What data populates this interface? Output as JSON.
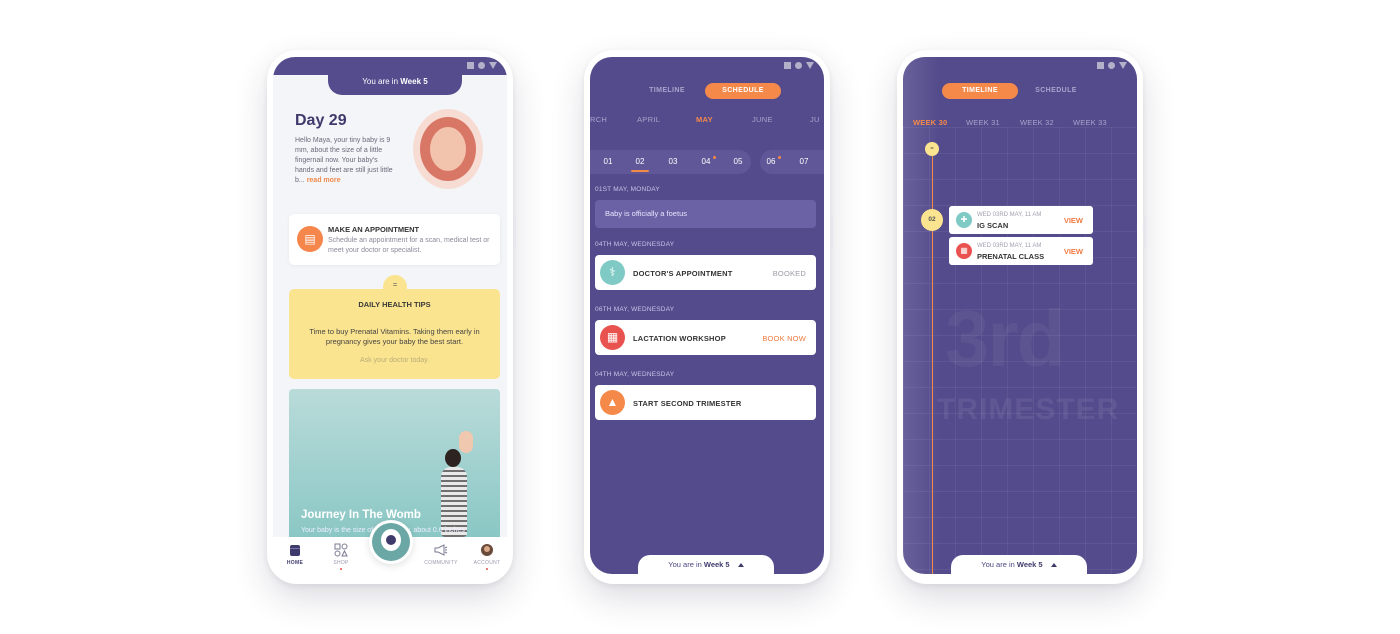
{
  "phone_home": {
    "week_banner": {
      "prefix": "You are in",
      "week": "Week 5"
    },
    "day_title": "Day 29",
    "day_text": "Hello Maya, your tiny baby is 9 mm, about the size of a little fingernail now. Your baby's hands and feet are still just little b...",
    "read_more": "read more",
    "appointment": {
      "title": "MAKE AN APPOINTMENT",
      "description": "Schedule an appointment for a scan, medical test or meet your doctor or specialist.",
      "icon": "clipboard-icon"
    },
    "tips": {
      "knob": "=",
      "title": "DAILY HEALTH TIPS",
      "text": "Time to buy Prenatal Vitamins. Taking them early in pregnancy gives your baby the best start.",
      "ask": "Ask your doctor today."
    },
    "journey": {
      "title": "Journey In The Womb",
      "subtitle": "Your baby is the size of a blueberry, about 0.6 inches"
    },
    "nav": [
      {
        "label": "HOME",
        "icon": "home-icon",
        "active": true
      },
      {
        "label": "SHOP",
        "icon": "shop-icon"
      },
      {
        "label": "COMMUNITY",
        "icon": "megaphone-icon"
      },
      {
        "label": "ACCOUNT",
        "icon": "avatar-icon"
      }
    ]
  },
  "phone_schedule": {
    "tabs": {
      "timeline": "TIMELINE",
      "schedule": "SCHEDULE",
      "active": "schedule"
    },
    "months": {
      "prev_partial": "RCH",
      "m1": "APRIL",
      "m2": "MAY",
      "m3": "JUNE",
      "next_partial": "JU",
      "active": "MAY"
    },
    "dates": {
      "d1": "01",
      "d2": "02",
      "d3": "03",
      "d4": "04",
      "d5": "05",
      "d6": "06",
      "d7": "07",
      "selected": "02"
    },
    "entries": {
      "h1": "01ST MAY, MONDAY",
      "foetus": "Baby is officially a foetus",
      "h2": "04TH MAY, WEDNESDAY",
      "e1_title": "DOCTOR'S APPOINTMENT",
      "e1_status": "BOOKED",
      "h3": "06TH MAY, WEDNESDAY",
      "e2_title": "LACTATION WORKSHOP",
      "e2_status": "BOOK NOW",
      "h4": "04TH MAY, WEDNESDAY",
      "e3_title": "START SECOND TRIMESTER"
    },
    "week_banner": {
      "prefix": "You are in",
      "week": "Week 5"
    }
  },
  "phone_timeline": {
    "tabs": {
      "timeline": "TIMELINE",
      "schedule": "SCHEDULE",
      "active": "timeline"
    },
    "weeks": {
      "w1": "WEEK 30",
      "w2": "WEEK 31",
      "w3": "WEEK 32",
      "w4": "WEEK 33",
      "active": "WEEK 30"
    },
    "top_marker": "=",
    "badge": "02",
    "events": {
      "e1_date": "WED 03RD MAY, 11 AM",
      "e1_title": "IG SCAN",
      "e2_date": "WED 03RD MAY, 11 AM",
      "e2_title": "PRENATAL CLASS",
      "view": "VIEW"
    },
    "trimester": {
      "number": "3rd",
      "word": "TRIMESTER"
    },
    "week_banner": {
      "prefix": "You are in",
      "week": "Week 5"
    }
  },
  "colors": {
    "brand_purple": "#544b8c",
    "accent_orange": "#f5894a",
    "tips_yellow": "#fbe48f",
    "teal": "#7fcac5",
    "red": "#e8524f"
  }
}
